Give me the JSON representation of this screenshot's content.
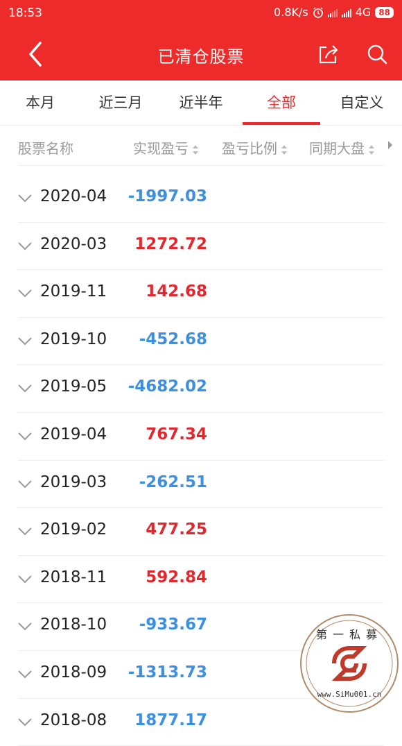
{
  "status_bar": {
    "time": "18:53",
    "speed": "0.8K/s",
    "network": "4G",
    "battery": "88"
  },
  "header": {
    "title": "已清仓股票",
    "icons": [
      "back-icon",
      "share-icon",
      "search-icon"
    ]
  },
  "tabs": [
    {
      "label": "本月",
      "active": false
    },
    {
      "label": "近三月",
      "active": false
    },
    {
      "label": "近半年",
      "active": false
    },
    {
      "label": "全部",
      "active": true
    },
    {
      "label": "自定义",
      "active": false
    }
  ],
  "columns": [
    "股票名称",
    "实现盈亏",
    "盈亏比例",
    "同期大盘"
  ],
  "rows": [
    {
      "date": "2020-04",
      "value": "-1997.03",
      "sign": "neg"
    },
    {
      "date": "2020-03",
      "value": "1272.72",
      "sign": "pos"
    },
    {
      "date": "2019-11",
      "value": "142.68",
      "sign": "pos"
    },
    {
      "date": "2019-10",
      "value": "-452.68",
      "sign": "neg"
    },
    {
      "date": "2019-05",
      "value": "-4682.02",
      "sign": "neg"
    },
    {
      "date": "2019-04",
      "value": "767.34",
      "sign": "pos"
    },
    {
      "date": "2019-03",
      "value": "-262.51",
      "sign": "neg"
    },
    {
      "date": "2019-02",
      "value": "477.25",
      "sign": "pos"
    },
    {
      "date": "2018-11",
      "value": "592.84",
      "sign": "pos"
    },
    {
      "date": "2018-10",
      "value": "-933.67",
      "sign": "neg"
    },
    {
      "date": "2018-09",
      "value": "-1313.73",
      "sign": "neg"
    },
    {
      "date": "2018-08",
      "value": "1877.17",
      "sign": "neg"
    }
  ],
  "watermark": {
    "top_text": "第一私募",
    "bottom_text": "www.SiMu001.cn"
  },
  "colors": {
    "brand_red": "#ee2b2b",
    "gain": "#e0282f",
    "loss": "#3d8fe0"
  }
}
